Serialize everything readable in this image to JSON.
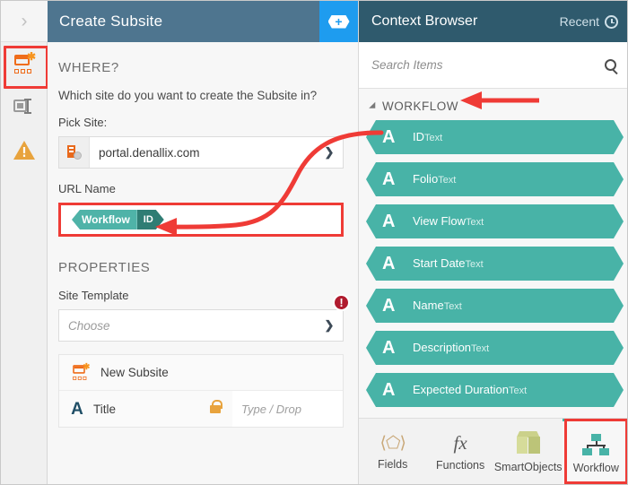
{
  "window": {
    "left_header_title": "Create Subsite",
    "add_button_icon": "hex-plus-icon",
    "collapse_icon": "chevron-right-icon"
  },
  "rail": {
    "items": [
      {
        "name": "new-subsite",
        "icon": "new-subsite-icon",
        "selected": true
      },
      {
        "name": "text-field",
        "icon": "text-field-icon",
        "selected": false
      },
      {
        "name": "warning",
        "icon": "warning-triangle-icon",
        "selected": false
      }
    ]
  },
  "form": {
    "where_heading": "WHERE?",
    "where_question": "Which site do you want to create the Subsite in?",
    "pick_site_label": "Pick Site:",
    "pick_site_value": "portal.denallix.com",
    "url_name_label": "URL Name",
    "url_token": {
      "prefix": "Workflow",
      "suffix": "ID"
    },
    "properties_heading": "PROPERTIES",
    "site_template_label": "Site Template",
    "site_template_placeholder": "Choose",
    "site_template_error": "!",
    "card": {
      "title_row": "New Subsite",
      "field_name": "Title",
      "field_type_icon": "letter-a-icon",
      "lock_icon": "lock-open-icon",
      "drop_placeholder": "Type / Drop"
    }
  },
  "context_browser": {
    "title": "Context Browser",
    "recent_label": "Recent",
    "recent_icon": "clock-icon",
    "search_placeholder": "Search Items",
    "search_icon": "magnifier-icon",
    "group_label": "WORKFLOW",
    "group_collapse_icon": "triangle-down-icon",
    "items": [
      {
        "name": "ID",
        "type": "Text",
        "icon": "letter-a-icon"
      },
      {
        "name": "Folio",
        "type": "Text",
        "icon": "letter-a-icon"
      },
      {
        "name": "View Flow",
        "type": "Text",
        "icon": "letter-a-icon"
      },
      {
        "name": "Start Date",
        "type": "Text",
        "icon": "letter-a-icon"
      },
      {
        "name": "Name",
        "type": "Text",
        "icon": "letter-a-icon"
      },
      {
        "name": "Description",
        "type": "Text",
        "icon": "letter-a-icon"
      },
      {
        "name": "Expected Duration",
        "type": "Text",
        "icon": "letter-a-icon"
      }
    ],
    "tabs": [
      {
        "label": "Fields",
        "icon": "fields-icon",
        "selected": false
      },
      {
        "label": "Functions",
        "icon": "fx-icon",
        "selected": false
      },
      {
        "label": "SmartObjects",
        "icon": "cube-icon",
        "selected": false
      },
      {
        "label": "Workflow",
        "icon": "workflow-icon",
        "selected": true
      }
    ]
  },
  "colors": {
    "header_blue": "#4e758f",
    "add_blue": "#1e9cef",
    "panel_header": "#2f5a6d",
    "teal": "#48b3a7",
    "teal_dark": "#2f7d74",
    "annotation_red": "#ef3b36",
    "error_red": "#b01b2e",
    "orange": "#ef6c1a"
  },
  "annotations": {
    "highlight_rail_item": "new-subsite",
    "highlight_url_field": true,
    "highlight_workflow_tab": true,
    "arrow_to_workflow_group": true,
    "curved_arrow_id_to_url": true
  }
}
